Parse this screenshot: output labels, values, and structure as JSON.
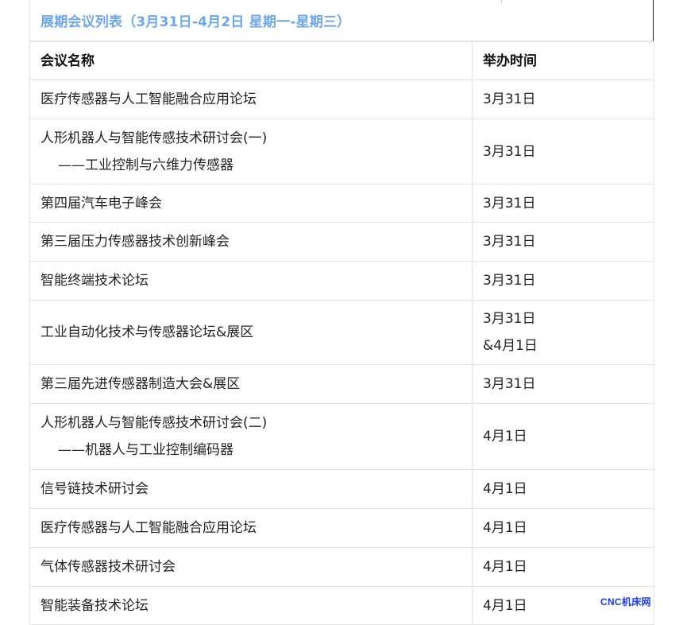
{
  "header": {
    "title": "展期会议列表（3月31日-4月2日 星期一-星期三）"
  },
  "table": {
    "columns": [
      "会议名称",
      "举办时间"
    ],
    "rows": [
      {
        "name": "医疗传感器与人工智能融合应用论坛",
        "sub": "",
        "date": "3月31日",
        "date2": ""
      },
      {
        "name": "人形机器人与智能传感技术研讨会(一)",
        "sub": "——工业控制与六维力传感器",
        "date": "3月31日",
        "date2": ""
      },
      {
        "name": "第四届汽车电子峰会",
        "sub": "",
        "date": "3月31日",
        "date2": ""
      },
      {
        "name": "第三届压力传感器技术创新峰会",
        "sub": "",
        "date": "3月31日",
        "date2": ""
      },
      {
        "name": "智能终端技术论坛",
        "sub": "",
        "date": "3月31日",
        "date2": ""
      },
      {
        "name": "工业自动化技术与传感器论坛&展区",
        "sub": "",
        "date": "3月31日",
        "date2": "&4月1日"
      },
      {
        "name": "第三届先进传感器制造大会&展区",
        "sub": "",
        "date": "3月31日",
        "date2": ""
      },
      {
        "name": "人形机器人与智能传感技术研讨会(二)",
        "sub": "——机器人与工业控制编码器",
        "date": "4月1日",
        "date2": ""
      },
      {
        "name": "信号链技术研讨会",
        "sub": "",
        "date": "4月1日",
        "date2": ""
      },
      {
        "name": "医疗传感器与人工智能融合应用论坛",
        "sub": "",
        "date": "4月1日",
        "date2": ""
      },
      {
        "name": "气体传感器技术研讨会",
        "sub": "",
        "date": "4月1日",
        "date2": ""
      },
      {
        "name": "智能装备技术论坛",
        "sub": "",
        "date": "4月1日",
        "date2": ""
      }
    ]
  },
  "watermark": {
    "text": "CNC机床网",
    "color": "#1d3bd6"
  },
  "colors": {
    "title": "#6fa7e3",
    "border": "#e2e2e2",
    "text": "#222222"
  }
}
